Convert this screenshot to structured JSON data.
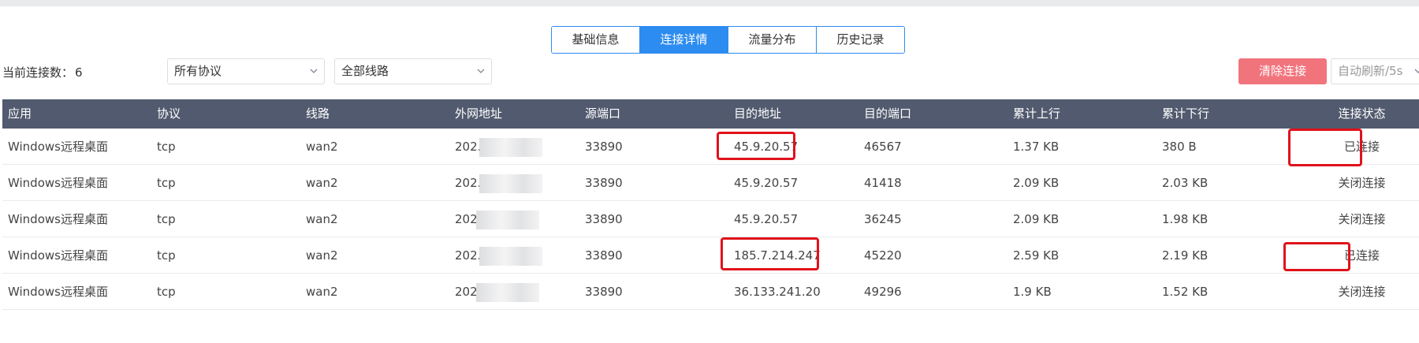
{
  "tabs": [
    "基础信息",
    "连接详情",
    "流量分布",
    "历史记录"
  ],
  "active_tab_index": 1,
  "toolbar": {
    "conn_count_label": "当前连接数：",
    "conn_count": "6",
    "protocol_select": "所有协议",
    "line_select": "全部线路",
    "clear_button": "清除连接",
    "refresh_select": "自动刷新/5s"
  },
  "colors": {
    "accent": "#2d8cf0",
    "header_bg": "#515a6e",
    "clear_button_bg": "#f1747d",
    "highlight_box": "#e0121b"
  },
  "table": {
    "headers": [
      "应用",
      "协议",
      "线路",
      "外网地址",
      "源端口",
      "目的地址",
      "目的端口",
      "累计上行",
      "累计下行",
      "连接状态"
    ],
    "rows": [
      {
        "app": "Windows远程桌面",
        "protocol": "tcp",
        "line": "wan2",
        "wan_ip": "202.",
        "src_port": "33890",
        "dst_ip": "45.9.20.57",
        "dst_port": "46567",
        "up": "1.37 KB",
        "down": "380 B",
        "status": "已连接"
      },
      {
        "app": "Windows远程桌面",
        "protocol": "tcp",
        "line": "wan2",
        "wan_ip": "202.",
        "src_port": "33890",
        "dst_ip": "45.9.20.57",
        "dst_port": "41418",
        "up": "2.09 KB",
        "down": "2.03 KB",
        "status": "关闭连接"
      },
      {
        "app": "Windows远程桌面",
        "protocol": "tcp",
        "line": "wan2",
        "wan_ip": "202",
        "src_port": "33890",
        "dst_ip": "45.9.20.57",
        "dst_port": "36245",
        "up": "2.09 KB",
        "down": "1.98 KB",
        "status": "关闭连接"
      },
      {
        "app": "Windows远程桌面",
        "protocol": "tcp",
        "line": "wan2",
        "wan_ip": "202.",
        "src_port": "33890",
        "dst_ip": "185.7.214.247",
        "dst_port": "45220",
        "up": "2.59 KB",
        "down": "2.19 KB",
        "status": "已连接"
      },
      {
        "app": "Windows远程桌面",
        "protocol": "tcp",
        "line": "wan2",
        "wan_ip": "202",
        "src_port": "33890",
        "dst_ip": "36.133.241.20",
        "dst_port": "49296",
        "up": "1.9 KB",
        "down": "1.52 KB",
        "status": "关闭连接"
      }
    ]
  },
  "icons": {
    "select_arrow": "chevron-down-icon"
  }
}
